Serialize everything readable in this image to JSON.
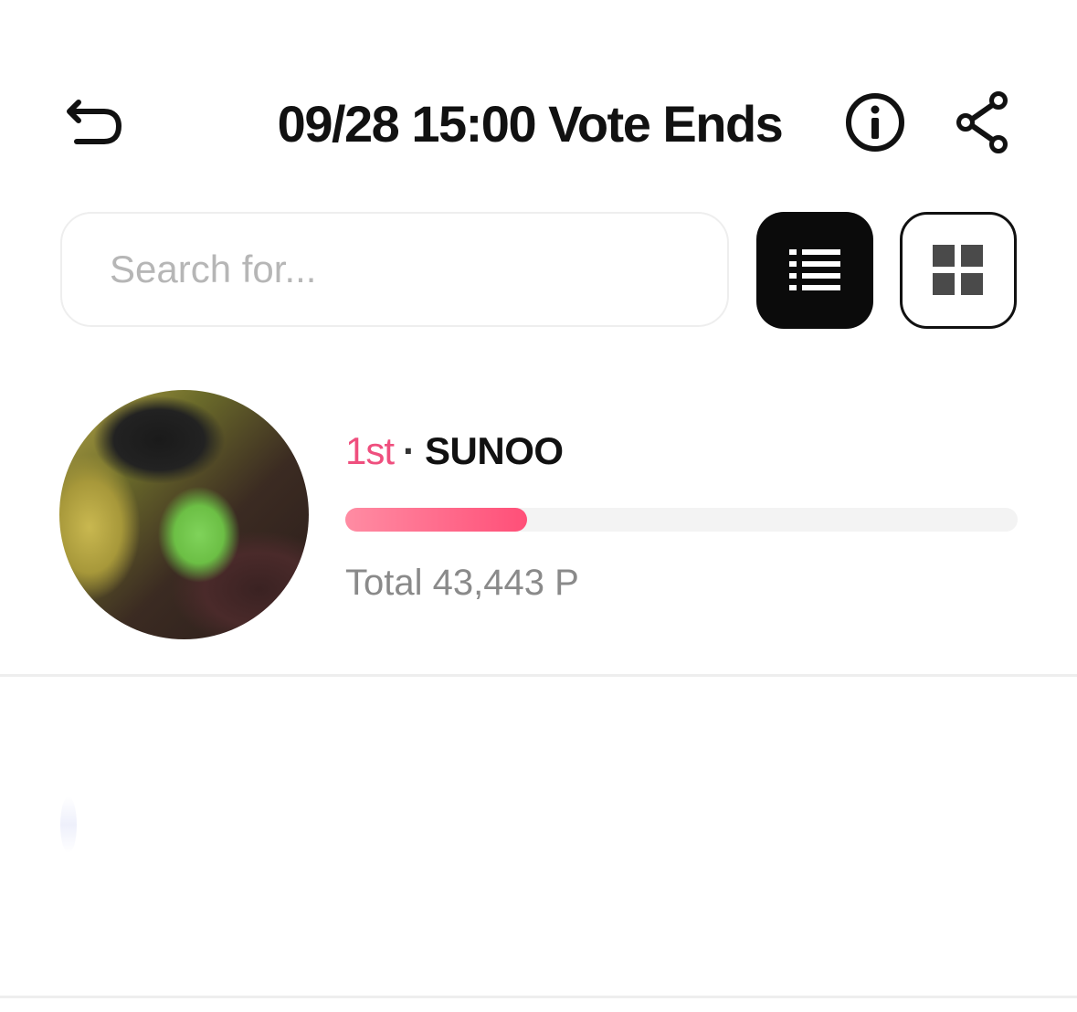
{
  "header": {
    "title": "09/28 15:00 Vote Ends",
    "back_icon": "undo-arrow-icon",
    "info_icon": "info-circle-icon",
    "share_icon": "share-icon"
  },
  "search": {
    "placeholder": "Search for..."
  },
  "view_toggle": {
    "list_icon": "list-view-icon",
    "grid_icon": "grid-view-icon",
    "active": "list"
  },
  "candidates": [
    {
      "rank": "1st",
      "separator": "·",
      "name": "SUNOO",
      "total": "Total 43,443 P",
      "progress": 0.27
    }
  ],
  "colors": {
    "rank": "#ef4f7e",
    "progress_start": "#ff8ca3",
    "progress_end": "#ff4f78",
    "track": "#f3f3f3",
    "active_toggle": "#0b0b0b"
  }
}
